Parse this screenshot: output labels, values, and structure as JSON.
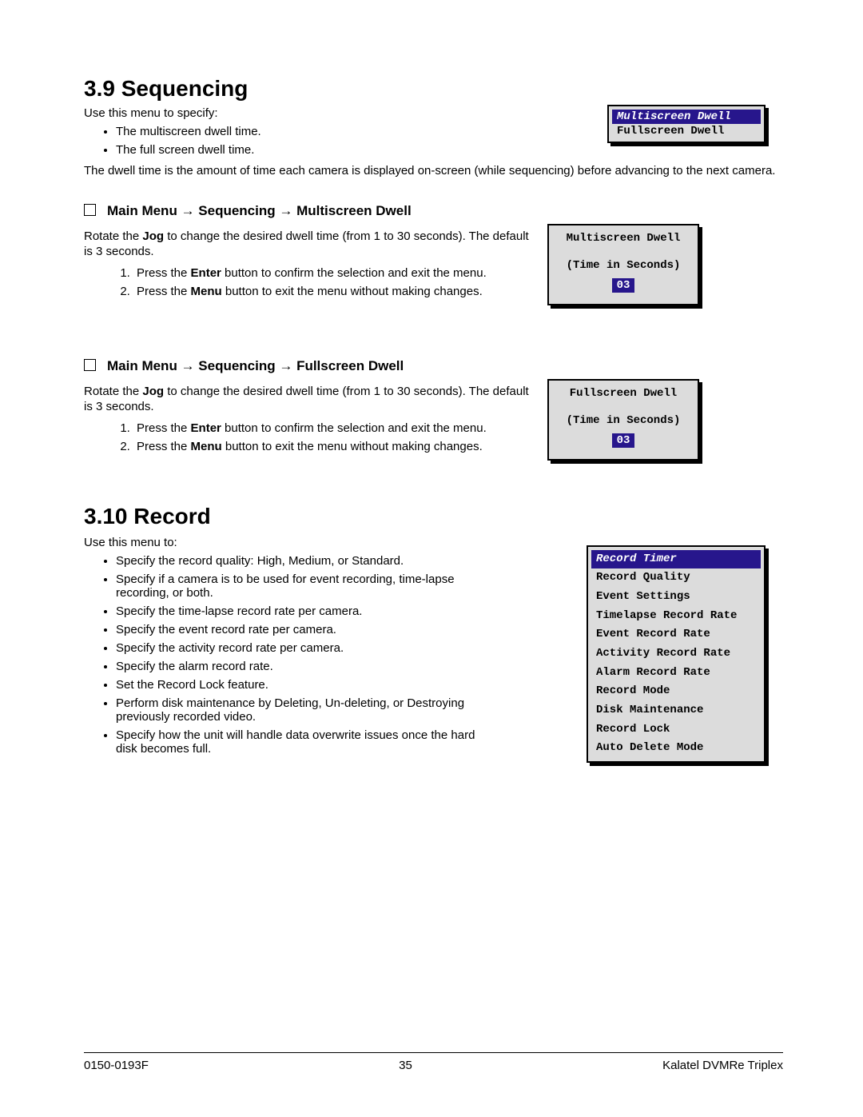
{
  "s1": {
    "heading": "3.9 Sequencing",
    "intro": "Use this menu to specify:",
    "bullets": [
      "The multiscreen dwell time.",
      "The full screen dwell time."
    ],
    "para": "The dwell time is the amount of time each camera is displayed on-screen (while sequencing) before advancing to the next camera.",
    "menu": {
      "sel": "Multiscreen Dwell",
      "other": "Fullscreen Dwell"
    }
  },
  "sub1": {
    "title": "Main Menu → Sequencing → Multiscreen Dwell",
    "body_pre": "Rotate the ",
    "body_bold": "Jog",
    "body_post": " to change the desired dwell time (from 1 to 30 seconds). The default is 3 seconds.",
    "step1_pre": "Press the ",
    "step1_bold": "Enter",
    "step1_post": " button to confirm the selection and exit the menu.",
    "step2_pre": "Press the ",
    "step2_bold": "Menu",
    "step2_post": " button to exit the menu without making changes.",
    "box": {
      "hdr": "Multiscreen Dwell",
      "lbl": "(Time in Seconds)",
      "val": "03"
    }
  },
  "sub2": {
    "title": "Main Menu → Sequencing → Fullscreen Dwell",
    "body_pre": "Rotate the ",
    "body_bold": "Jog",
    "body_post": " to change the desired dwell time (from 1 to 30 seconds). The default is 3 seconds.",
    "step1_pre": "Press the ",
    "step1_bold": "Enter",
    "step1_post": " button to confirm the selection and exit the menu.",
    "step2_pre": "Press the ",
    "step2_bold": "Menu",
    "step2_post": " button to exit the menu without making changes.",
    "box": {
      "hdr": "Fullscreen Dwell",
      "lbl": "(Time in Seconds)",
      "val": "03"
    }
  },
  "s2": {
    "heading": "3.10 Record",
    "intro": "Use this menu to:",
    "bullets": [
      "Specify the record quality:  High, Medium, or Standard.",
      "Specify if a camera is to be used for event recording, time-lapse recording, or both.",
      "Specify the time-lapse record rate per camera.",
      "Specify the event record rate per camera.",
      "Specify the activity record rate per camera.",
      "Specify the alarm record rate.",
      "Set the Record Lock feature.",
      "Perform disk maintenance by Deleting, Un-deleting, or Destroying previously recorded video.",
      "Specify how the unit will handle data overwrite issues once the hard disk becomes full."
    ],
    "menu": [
      "Record Timer",
      "Record Quality",
      "Event Settings",
      "Timelapse Record Rate",
      "Event Record Rate",
      "Activity Record Rate",
      "Alarm Record Rate",
      "Record Mode",
      "Disk Maintenance",
      "Record Lock",
      "Auto Delete Mode"
    ]
  },
  "footer": {
    "left": "0150-0193F",
    "center": "35",
    "right": "Kalatel DVMRe Triplex"
  }
}
